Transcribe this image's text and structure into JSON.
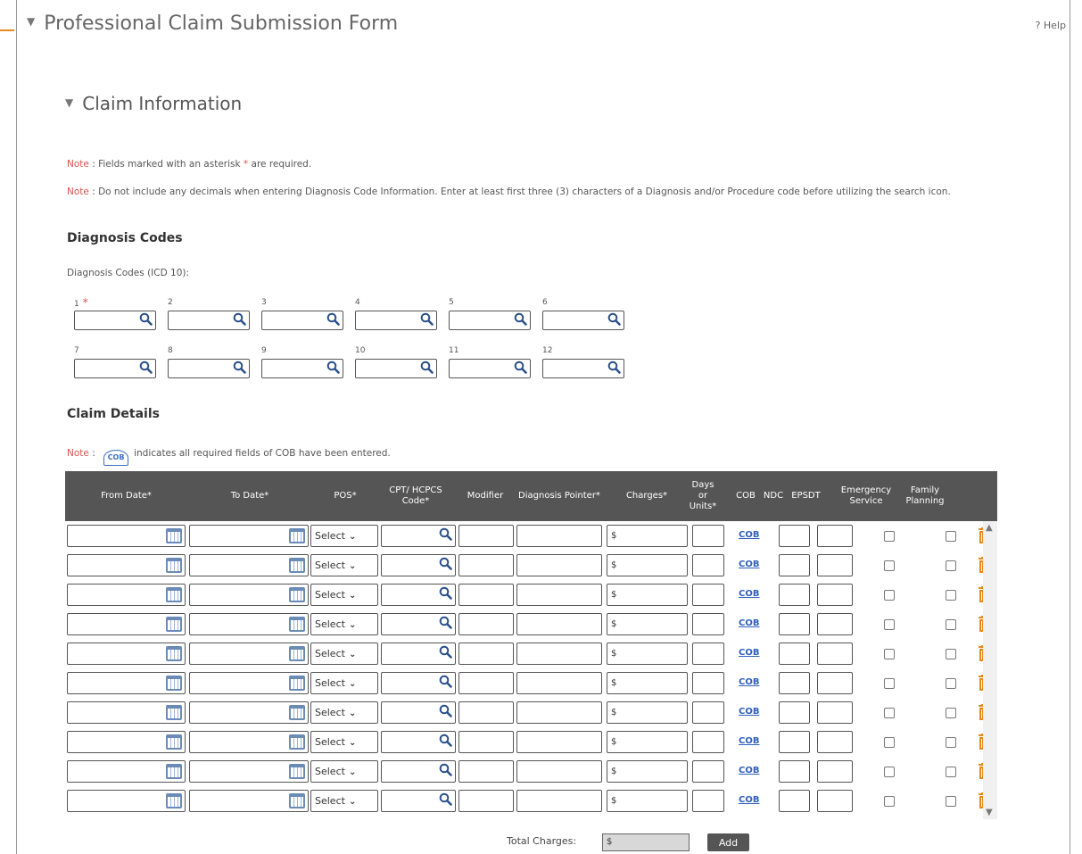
{
  "form": {
    "title": "Professional Claim Submission Form",
    "help_label": "? Help"
  },
  "section": {
    "title": "Claim Information"
  },
  "notes": {
    "label": "Note",
    "required_text": " : Fields marked with an asterisk ",
    "required_asterisk": "*",
    "required_tail": " are required.",
    "decimals_text": " : Do not include any decimals when entering Diagnosis Code Information. Enter at least first three (3) characters of a Diagnosis and/or Procedure code before utilizing the search icon.",
    "cob_prefix": " : ",
    "cob_icon_text": "COB",
    "cob_text": "indicates all required fields of COB have been entered."
  },
  "diagnosis": {
    "heading": "Diagnosis Codes",
    "label": "Diagnosis Codes (ICD 10):",
    "required_marker": "*",
    "codes": [
      "1",
      "2",
      "3",
      "4",
      "5",
      "6",
      "7",
      "8",
      "9",
      "10",
      "11",
      "12"
    ]
  },
  "claim_details": {
    "heading": "Claim Details",
    "columns": {
      "from_date": "From Date*",
      "to_date": "To Date*",
      "pos": "POS*",
      "cpt": "CPT/ HCPCS Code*",
      "modifier": "Modifier",
      "diagnosis_pointer": "Diagnosis Pointer*",
      "charges": "Charges*",
      "days_units": "Days or Units*",
      "cob": "COB",
      "ndc": "NDC",
      "epsdt": "EPSDT",
      "emergency": "Emergency Service",
      "family_planning": "Family Planning"
    },
    "row_defaults": {
      "pos_select": "Select",
      "charges_prefix": "$",
      "cob_link": "COB"
    },
    "row_count": 10
  },
  "totals": {
    "label": "Total Charges:",
    "value": "$",
    "add_label": "Add"
  },
  "colors": {
    "header_bg": "#555555",
    "link": "#2d5fbf",
    "note_red": "#d9534f",
    "trash": "#e8891c",
    "accent": "#e8891c"
  }
}
